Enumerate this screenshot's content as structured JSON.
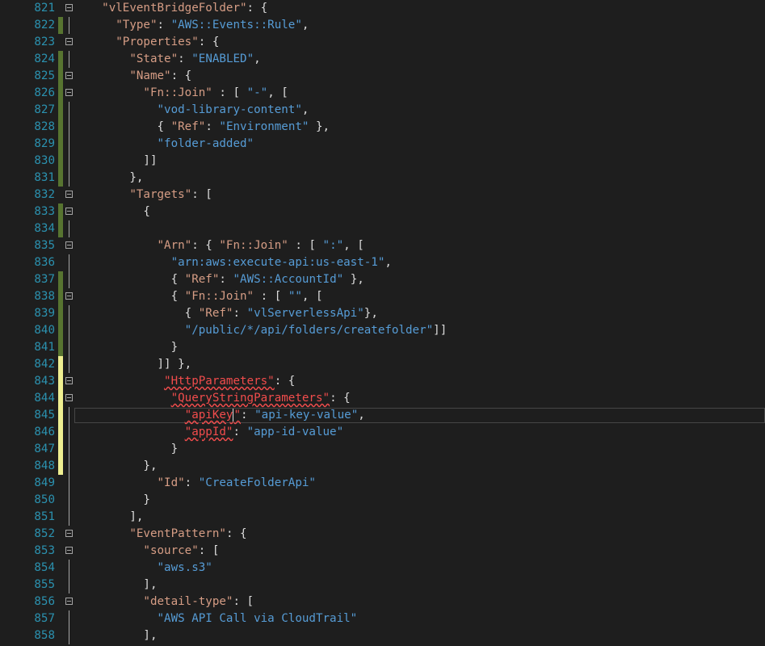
{
  "colors": {
    "background": "#1e1e1e",
    "line_number": "#2b91af",
    "property_key": "#d69d85",
    "string_value": "#569cd6",
    "punctuation": "#dcdcdc",
    "error_key": "#f14c4c",
    "change_saved": "#577430",
    "change_unsaved": "#efef91"
  },
  "lines": [
    {
      "n": "821",
      "code": "    \"vlEventBridgeFolder\": {"
    },
    {
      "n": "822",
      "code": "      \"Type\": \"AWS::Events::Rule\","
    },
    {
      "n": "823",
      "code": "      \"Properties\": {"
    },
    {
      "n": "824",
      "code": "        \"State\": \"ENABLED\","
    },
    {
      "n": "825",
      "code": "        \"Name\": {"
    },
    {
      "n": "826",
      "code": "          \"Fn::Join\" : [ \"-\", ["
    },
    {
      "n": "827",
      "code": "            \"vod-library-content\","
    },
    {
      "n": "828",
      "code": "            { \"Ref\": \"Environment\" },"
    },
    {
      "n": "829",
      "code": "            \"folder-added\""
    },
    {
      "n": "830",
      "code": "          ]]"
    },
    {
      "n": "831",
      "code": "        },"
    },
    {
      "n": "832",
      "code": "        \"Targets\": ["
    },
    {
      "n": "833",
      "code": "          {"
    },
    {
      "n": "834",
      "code": ""
    },
    {
      "n": "835",
      "code": "            \"Arn\": { \"Fn::Join\" : [ \":\", ["
    },
    {
      "n": "836",
      "code": "              \"arn:aws:execute-api:us-east-1\","
    },
    {
      "n": "837",
      "code": "              { \"Ref\": \"AWS::AccountId\" },"
    },
    {
      "n": "838",
      "code": "              { \"Fn::Join\" : [ \"\", ["
    },
    {
      "n": "839",
      "code": "                { \"Ref\": \"vlServerlessApi\"},"
    },
    {
      "n": "840",
      "code": "                \"/public/*/api/folders/createfolder\"]]"
    },
    {
      "n": "841",
      "code": "              }"
    },
    {
      "n": "842",
      "code": "            ]] },"
    },
    {
      "n": "843",
      "code": "             \"HttpParameters\": {"
    },
    {
      "n": "844",
      "code": "              \"QueryStringParameters\": {"
    },
    {
      "n": "845",
      "code": "                \"apiKey\": \"api-key-value\","
    },
    {
      "n": "846",
      "code": "                \"appId\": \"app-id-value\""
    },
    {
      "n": "847",
      "code": "              }"
    },
    {
      "n": "848",
      "code": "          },"
    },
    {
      "n": "849",
      "code": "            \"Id\": \"CreateFolderApi\""
    },
    {
      "n": "850",
      "code": "          }"
    },
    {
      "n": "851",
      "code": "        ],"
    },
    {
      "n": "852",
      "code": "        \"EventPattern\": {"
    },
    {
      "n": "853",
      "code": "          \"source\": ["
    },
    {
      "n": "854",
      "code": "            \"aws.s3\""
    },
    {
      "n": "855",
      "code": "          ],"
    },
    {
      "n": "856",
      "code": "          \"detail-type\": ["
    },
    {
      "n": "857",
      "code": "            \"AWS API Call via CloudTrail\""
    },
    {
      "n": "858",
      "code": "          ],"
    }
  ]
}
